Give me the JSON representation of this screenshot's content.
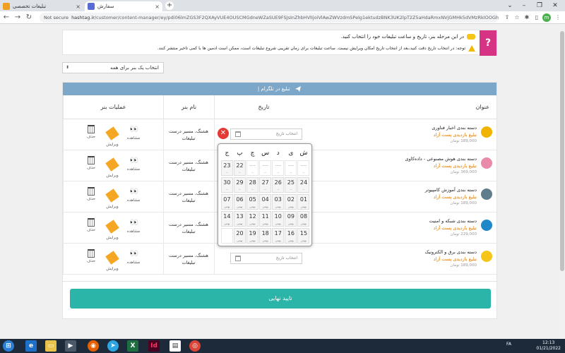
{
  "browser": {
    "tab1_title": "تبلیغات تخصصی",
    "tab2_title": "سفارش",
    "new_tab": "+",
    "not_secure": "Not secure",
    "host": "hashtag.ir",
    "url_path": "/customer/content-manager/ey/pdi06lmZGS3F2QXAyVUE4OUSCMGdneWZaSUE9FSJsInZhbHVlIjoiVlAwZWVzdmSPelg1ektudzBNK3UK2lpT2Z5aHdaRmxNVjGMHk5dVMzRkIOOGhQVTFOZ0ZI...",
    "profile_letter": "m"
  },
  "notice": {
    "qmark": "?",
    "line1": "در این مرحله بنر، تاریخ و ساعت تبلیغات خود را انتخاب کنید.",
    "line2": "توجه: در انتخاب تاریخ دقت کنید،بعد از انتخاب تاریخ امکان ویرایش نیست. ساعت تبلیغات برای زمان تقریبی شروع تبلیغات است، ممکن است ادمین ها با کمی تاخیر منتشر کنند."
  },
  "select": {
    "value": "انتخاب یک بنر برای همه",
    "arrow": "⬍"
  },
  "table": {
    "header": "تبلیغ در تلگرام |",
    "columns": {
      "title": "عنوان",
      "date": "تاریخ",
      "banner": "نام بنر",
      "ops": "عملیات بنر"
    },
    "rows": [
      {
        "title": "دسته بندی اخبار فناوری",
        "sub": "تبلیغ بازدیدی پست آزاد",
        "price": "189,000 تومان",
        "banner": "هشتگ، مسیر درست تبلیغات",
        "date_placeholder": "انتخاب تاریخ",
        "icon_color": "#f0b400"
      },
      {
        "title": "دسته بندی هوش مصنوعی - داده‌کاوی",
        "sub": "تبلیغ بازدیدی پست آزاد",
        "price": "369,000 تومان",
        "banner": "هشتگ، مسیر درست تبلیغات",
        "date_placeholder": "",
        "icon_color": "#e88aa8"
      },
      {
        "title": "دسته بندی آموزش کامپیوتر",
        "sub": "تبلیغ بازدیدی پست آزاد",
        "price": "189,000 تومان",
        "banner": "هشتگ، مسیر درست تبلیغات",
        "date_placeholder": "",
        "icon_color": "#607d8b"
      },
      {
        "title": "دسته بندی شبکه و امنیت",
        "sub": "تبلیغ بازدیدی پست آزاد",
        "price": "229,000 تومان",
        "banner": "هشتگ، مسیر درست تبلیغات",
        "date_placeholder": "",
        "icon_color": "#1e88c8"
      },
      {
        "title": "دسته بندی برق و الکترونیک",
        "sub": "تبلیغ بازدیدی پست آزاد",
        "price": "189,000 تومان",
        "banner": "هشتگ، مسیر درست تبلیغات",
        "date_placeholder": "انتخاب تاریخ",
        "icon_color": "#f5c518"
      }
    ],
    "ops_labels": {
      "view": "مشاهده",
      "edit": "ویرایش",
      "delete": "حذف"
    }
  },
  "calendar": {
    "weekdays": [
      "ش",
      "ی",
      "د",
      "س",
      "چ",
      "پ",
      "ج"
    ],
    "weeks": [
      [
        {
          "d": "----",
          "m": "--"
        },
        {
          "d": "----",
          "m": "--"
        },
        {
          "d": "----",
          "m": "--"
        },
        {
          "d": "----",
          "m": "--"
        },
        {
          "d": "----",
          "m": "--"
        },
        {
          "d": "22",
          "m": "--"
        },
        {
          "d": "23",
          "m": "--"
        }
      ],
      [
        {
          "d": "24",
          "m": "--"
        },
        {
          "d": "25",
          "m": "--"
        },
        {
          "d": "26",
          "m": "--"
        },
        {
          "d": "27",
          "m": "--"
        },
        {
          "d": "28",
          "m": "--"
        },
        {
          "d": "29",
          "m": "--"
        },
        {
          "d": "30",
          "m": "--"
        }
      ],
      [
        {
          "d": "01",
          "m": "بهمن"
        },
        {
          "d": "02",
          "m": "بهمن"
        },
        {
          "d": "03",
          "m": "بهمن"
        },
        {
          "d": "04",
          "m": "بهمن"
        },
        {
          "d": "05",
          "m": "بهمن"
        },
        {
          "d": "06",
          "m": "بهمن"
        },
        {
          "d": "07",
          "m": "بهمن"
        }
      ],
      [
        {
          "d": "08",
          "m": "بهمن"
        },
        {
          "d": "09",
          "m": "بهمن"
        },
        {
          "d": "10",
          "m": "بهمن"
        },
        {
          "d": "11",
          "m": "بهمن"
        },
        {
          "d": "12",
          "m": "بهمن"
        },
        {
          "d": "13",
          "m": "بهمن"
        },
        {
          "d": "14",
          "m": "بهمن"
        }
      ],
      [
        {
          "d": "15",
          "m": "بهمن"
        },
        {
          "d": "16",
          "m": "بهمن"
        },
        {
          "d": "17",
          "m": "بهمن"
        },
        {
          "d": "18",
          "m": "بهمن"
        },
        {
          "d": "19",
          "m": "بهمن"
        },
        {
          "d": "20",
          "m": "بهمن"
        },
        {
          "d": "",
          "m": ""
        }
      ]
    ],
    "clear": "✕"
  },
  "confirm": {
    "label": "تایید نهایی"
  },
  "taskbar": {
    "time": "12:13",
    "date": "01/21/2022",
    "lang": "FA"
  },
  "colors": {
    "accent": "#2ab5a8",
    "header": "#7da7c9",
    "danger": "#e53935"
  }
}
